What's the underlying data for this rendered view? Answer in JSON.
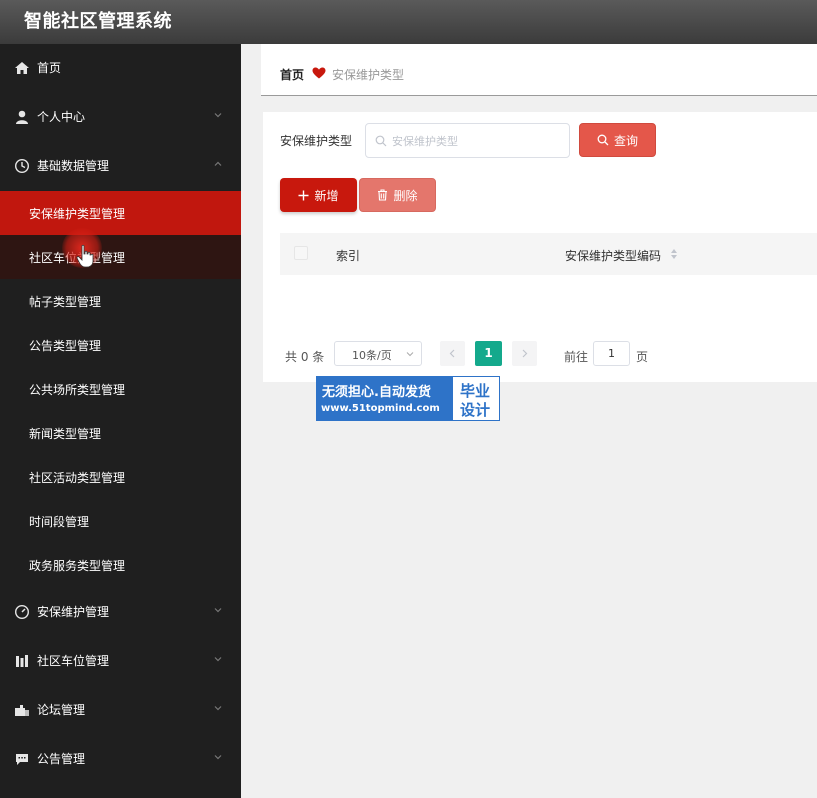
{
  "app": {
    "title": "智能社区管理系统"
  },
  "sidebar": {
    "menu": [
      {
        "label": "首页",
        "icon": "home-icon"
      },
      {
        "label": "个人中心",
        "icon": "user-icon"
      },
      {
        "label": "基础数据管理",
        "icon": "clock-icon",
        "expanded": true
      },
      {
        "label": "安保维护管理",
        "icon": "gauge-icon"
      },
      {
        "label": "社区车位管理",
        "icon": "building-icon"
      },
      {
        "label": "论坛管理",
        "icon": "forum-icon"
      },
      {
        "label": "公告管理",
        "icon": "message-icon"
      }
    ],
    "submenu": [
      {
        "label": "安保维护类型管理",
        "active": true
      },
      {
        "label": "社区车位类型管理"
      },
      {
        "label": "帖子类型管理"
      },
      {
        "label": "公告类型管理"
      },
      {
        "label": "公共场所类型管理"
      },
      {
        "label": "新闻类型管理"
      },
      {
        "label": "社区活动类型管理"
      },
      {
        "label": "时间段管理"
      },
      {
        "label": "政务服务类型管理"
      }
    ]
  },
  "breadcrumb": {
    "home": "首页",
    "current": "安保维护类型"
  },
  "search": {
    "label": "安保维护类型",
    "placeholder": "安保维护类型",
    "value": "",
    "button": "查询"
  },
  "actions": {
    "add": "新增",
    "delete": "删除"
  },
  "table": {
    "columns": [
      "索引",
      "安保维护类型编码"
    ],
    "rows": []
  },
  "pagination": {
    "total": "共 0 条",
    "page_size": "10条/页",
    "current_page": "1",
    "goto_label": "前往",
    "goto_value": "1",
    "page_suffix": "页"
  },
  "watermark": {
    "line1": "无须担心.自动发货",
    "line2": "www.51topmind.com",
    "right1": "毕业",
    "right2": "设计"
  },
  "colors": {
    "primary_red": "#c8180d",
    "query_red": "#e4574a",
    "delete_red": "#e4766c",
    "page_green": "#14a98c",
    "sidebar_bg": "#1f1f1f",
    "watermark_blue": "#2e73c8"
  }
}
